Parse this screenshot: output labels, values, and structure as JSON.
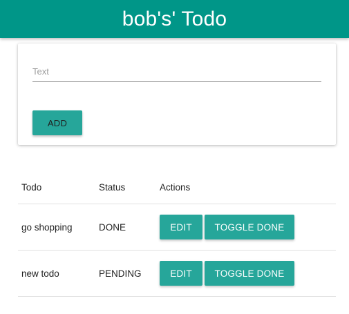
{
  "header": {
    "title": "bob's' Todo"
  },
  "form": {
    "text_placeholder": "Text",
    "text_value": "",
    "add_label": "ADD"
  },
  "table": {
    "headers": {
      "todo": "Todo",
      "status": "Status",
      "actions": "Actions"
    },
    "rows": [
      {
        "todo": "go shopping",
        "status": "DONE",
        "edit_label": "EDIT",
        "toggle_label": "TOGGLE DONE"
      },
      {
        "todo": "new todo",
        "status": "PENDING",
        "edit_label": "EDIT",
        "toggle_label": "TOGGLE DONE"
      }
    ]
  },
  "colors": {
    "header_bg": "#009688",
    "button_bg": "#26a69a"
  }
}
